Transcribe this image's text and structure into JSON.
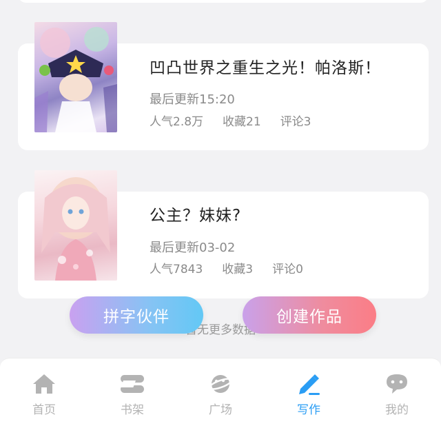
{
  "works": [
    {
      "title": "凹凸世界之重生之光！帕洛斯！",
      "updated": "最后更新15:20",
      "popularity": "人气2.8万",
      "favorites": "收藏21",
      "comments": "评论3"
    },
    {
      "title": "公主？妹妹?",
      "updated": "最后更新03-02",
      "popularity": "人气7843",
      "favorites": "收藏3",
      "comments": "评论0"
    }
  ],
  "list_end_text": "暂无更多数据",
  "actions": {
    "partner_label": "拼字伙伴",
    "create_label": "创建作品"
  },
  "tabbar": {
    "tabs": [
      {
        "label": "首页",
        "icon": "home-icon"
      },
      {
        "label": "书架",
        "icon": "bookshelf-icon"
      },
      {
        "label": "广场",
        "icon": "planet-icon"
      },
      {
        "label": "写作",
        "icon": "pen-icon",
        "active": true
      },
      {
        "label": "我的",
        "icon": "chat-bubble-icon"
      }
    ]
  },
  "colors": {
    "accent": "#2a9df4",
    "tab_inactive": "#b3b3b3",
    "partner_gradient": [
      "#c9a1f0",
      "#63c8f5"
    ],
    "create_gradient": [
      "#c9a1ea",
      "#fb7d86"
    ]
  }
}
